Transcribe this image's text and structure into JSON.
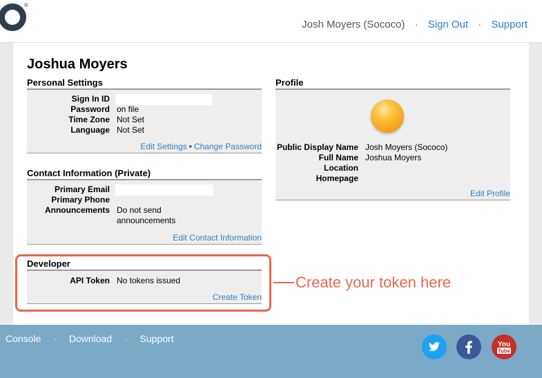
{
  "header": {
    "user_display": "Josh Moyers (Sococo)",
    "sign_out": "Sign Out",
    "support": "Support",
    "separator": "·",
    "registered_mark": "®"
  },
  "page": {
    "user_name": "Joshua Moyers",
    "personal_settings": {
      "title": "Personal Settings",
      "rows": [
        {
          "label": "Sign In ID",
          "value": ""
        },
        {
          "label": "Password",
          "value": "on file"
        },
        {
          "label": "Time Zone",
          "value": "Not Set"
        },
        {
          "label": "Language",
          "value": "Not Set"
        }
      ],
      "edit_settings": "Edit Settings",
      "link_separator": "•",
      "change_password": "Change Password"
    },
    "contact_information": {
      "title": "Contact Information (Private)",
      "rows": [
        {
          "label": "Primary Email",
          "value": ""
        },
        {
          "label": "Primary Phone",
          "value": ""
        },
        {
          "label": "Announcements",
          "value_line1": "Do not send",
          "value_line2": "announcements"
        }
      ],
      "edit_link": "Edit Contact Information"
    },
    "developer": {
      "title": "Developer",
      "rows": [
        {
          "label": "API Token",
          "value": "No tokens issued"
        }
      ],
      "create_token": "Create Token"
    },
    "profile": {
      "title": "Profile",
      "rows": [
        {
          "label": "Public Display Name",
          "value": "Josh Moyers (Sococo)"
        },
        {
          "label": "Full Name",
          "value": "Joshua Moyers"
        },
        {
          "label": "Location",
          "value": ""
        },
        {
          "label": "Homepage",
          "value": ""
        }
      ],
      "edit_profile": "Edit Profile"
    }
  },
  "annotation": {
    "callout": "Create your token here",
    "color": "#e8674f"
  },
  "footer": {
    "console": "Console",
    "download": "Download",
    "support": "Support",
    "separator": "·",
    "social_icons": [
      "twitter-icon",
      "facebook-icon",
      "youtube-icon"
    ]
  },
  "colors": {
    "link": "#2e7fbf",
    "footer_bg": "#7aaac7",
    "avatar": "#f7a11a"
  }
}
